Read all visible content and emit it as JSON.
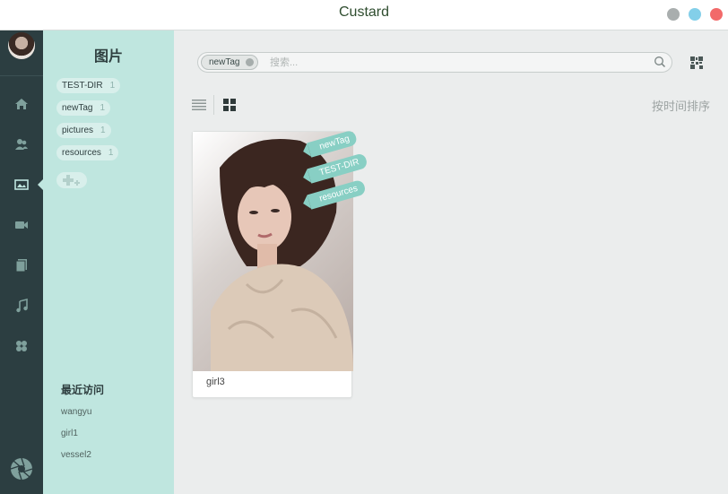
{
  "window": {
    "title": "Custard"
  },
  "colors": {
    "min": "#a9aeae",
    "max": "#83cfe9",
    "close": "#f26a6a",
    "rail_icon": "#7fa09c",
    "rail_active": "#bfe6df"
  },
  "rail": {
    "items": [
      {
        "icon": "home-icon"
      },
      {
        "icon": "users-icon"
      },
      {
        "icon": "image-icon",
        "active": true
      },
      {
        "icon": "video-icon"
      },
      {
        "icon": "document-icon"
      },
      {
        "icon": "music-icon"
      },
      {
        "icon": "apps-icon"
      }
    ]
  },
  "sidebar": {
    "heading": "图片",
    "tags": [
      {
        "label": "TEST-DIR",
        "count": "1"
      },
      {
        "label": "newTag",
        "count": "1"
      },
      {
        "label": "pictures",
        "count": "1"
      },
      {
        "label": "resources",
        "count": "1"
      }
    ],
    "recent_title": "最近访问",
    "recent": [
      "wangyu",
      "girl1",
      "vessel2"
    ]
  },
  "search": {
    "chip": "newTag",
    "placeholder": "搜索..."
  },
  "toolbar": {
    "sort_label": "按时间排序"
  },
  "cards": [
    {
      "caption": "girl3",
      "ribbons": [
        "newTag",
        "TEST-DIR",
        "resources"
      ]
    }
  ]
}
